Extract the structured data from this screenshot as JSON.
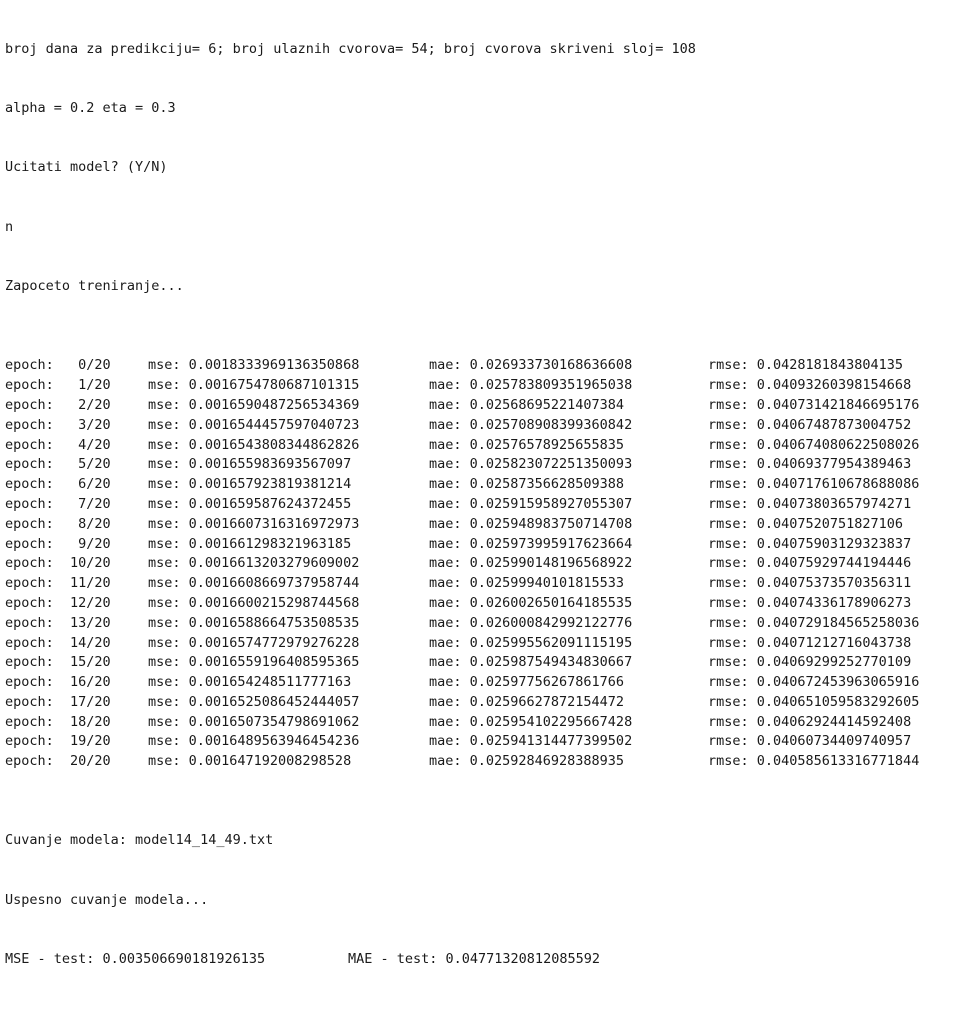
{
  "console": {
    "header_lines": [
      "broj dana za predikciju= 6; broj ulaznih cvorova= 54; broj cvorova skriveni sloj= 108",
      "alpha = 0.2 eta = 0.3",
      "Ucitati model? (Y/N)",
      "n",
      "Zapoceto treniranje..."
    ],
    "epochs": [
      {
        "epoch": "epoch:   0/20",
        "mse": "mse: 0.0018333969136350868",
        "mae": "mae: 0.026933730168636608",
        "rmse": "rmse: 0.0428181843804135"
      },
      {
        "epoch": "epoch:   1/20",
        "mse": "mse: 0.0016754780687101315",
        "mae": "mae: 0.025783809351965038",
        "rmse": "rmse: 0.04093260398154668"
      },
      {
        "epoch": "epoch:   2/20",
        "mse": "mse: 0.0016590487256534369",
        "mae": "mae: 0.02568695221407384",
        "rmse": "rmse: 0.040731421846695176"
      },
      {
        "epoch": "epoch:   3/20",
        "mse": "mse: 0.0016544457597040723",
        "mae": "mae: 0.025708908399360842",
        "rmse": "rmse: 0.04067487873004752"
      },
      {
        "epoch": "epoch:   4/20",
        "mse": "mse: 0.001654380834486282​6",
        "mae": "mae: 0.02576578925655835",
        "rmse": "rmse: 0.040674080622508026"
      },
      {
        "epoch": "epoch:   5/20",
        "mse": "mse: 0.001655983693567097",
        "mae": "mae: 0.025823072251350093",
        "rmse": "rmse: 0.04069377954389463"
      },
      {
        "epoch": "epoch:   6/20",
        "mse": "mse: 0.001657923819381214",
        "mae": "mae: 0.02587356628509388",
        "rmse": "rmse: 0.040717610678688086"
      },
      {
        "epoch": "epoch:   7/20",
        "mse": "mse: 0.001659587624372455",
        "mae": "mae: 0.025915958927055307",
        "rmse": "rmse: 0.040738036579742​71"
      },
      {
        "epoch": "epoch:   8/20",
        "mse": "mse: 0.0016607316316972973",
        "mae": "mae: 0.025948983750714708",
        "rmse": "rmse: 0.0407520751827106"
      },
      {
        "epoch": "epoch:   9/20",
        "mse": "mse: 0.001661298321963185",
        "mae": "mae: 0.025973995917623664",
        "rmse": "rmse: 0.04075903129323837"
      },
      {
        "epoch": "epoch:  10/20",
        "mse": "mse: 0.0016613203279609002",
        "mae": "mae: 0.025990148196568922",
        "rmse": "rmse: 0.04075929744194446"
      },
      {
        "epoch": "epoch:  11/20",
        "mse": "mse: 0.0016608669737958744",
        "mae": "mae: 0.02599940101815533",
        "rmse": "rmse: 0.04075373570356311"
      },
      {
        "epoch": "epoch:  12/20",
        "mse": "mse: 0.0016600215298744568",
        "mae": "mae: 0.026002650164185535",
        "rmse": "rmse: 0.04074336178906273"
      },
      {
        "epoch": "epoch:  13/20",
        "mse": "mse: 0.0016588664753508535",
        "mae": "mae: 0.026000842992122776",
        "rmse": "rmse: 0.04072918456525803​6"
      },
      {
        "epoch": "epoch:  14/20",
        "mse": "mse: 0.001657477297927622​8",
        "mae": "mae: 0.02599556209111519​5",
        "rmse": "rmse: 0.04071212716043738"
      },
      {
        "epoch": "epoch:  15/20",
        "mse": "mse: 0.001655919640859536​5",
        "mae": "mae: 0.025987549434830667",
        "rmse": "rmse: 0.04069299252770109"
      },
      {
        "epoch": "epoch:  16/20",
        "mse": "mse: 0.0016542485117​77163",
        "mae": "mae: 0.02597756267861766",
        "rmse": "rmse: 0.040672453963065916"
      },
      {
        "epoch": "epoch:  17/20",
        "mse": "mse: 0.0016525086452444057",
        "mae": "mae: 0.02596627872154472",
        "rmse": "rmse: 0.04065105958329260​5"
      },
      {
        "epoch": "epoch:  18/20",
        "mse": "mse: 0.0016507354798691062",
        "mae": "mae: 0.025954102295667428",
        "rmse": "rmse: 0.04062924414592408"
      },
      {
        "epoch": "epoch:  19/20",
        "mse": "mse: 0.0016489563946454236",
        "mae": "mae: 0.025941314477399502",
        "rmse": "rmse: 0.040607344097​40957"
      },
      {
        "epoch": "epoch:  20/20",
        "mse": "mse: 0.001647192008298528",
        "mae": "mae: 0.025928469283889​35",
        "rmse": "rmse: 0.040585613316771844"
      }
    ],
    "footer_lines": [
      "Cuvanje modela: model14_14_49.txt",
      "Uspesno cuvanje modela..."
    ],
    "final": {
      "mse": "MSE - test: 0.003506690181926135",
      "mae": "MAE - test: 0.04771320812085592"
    }
  }
}
